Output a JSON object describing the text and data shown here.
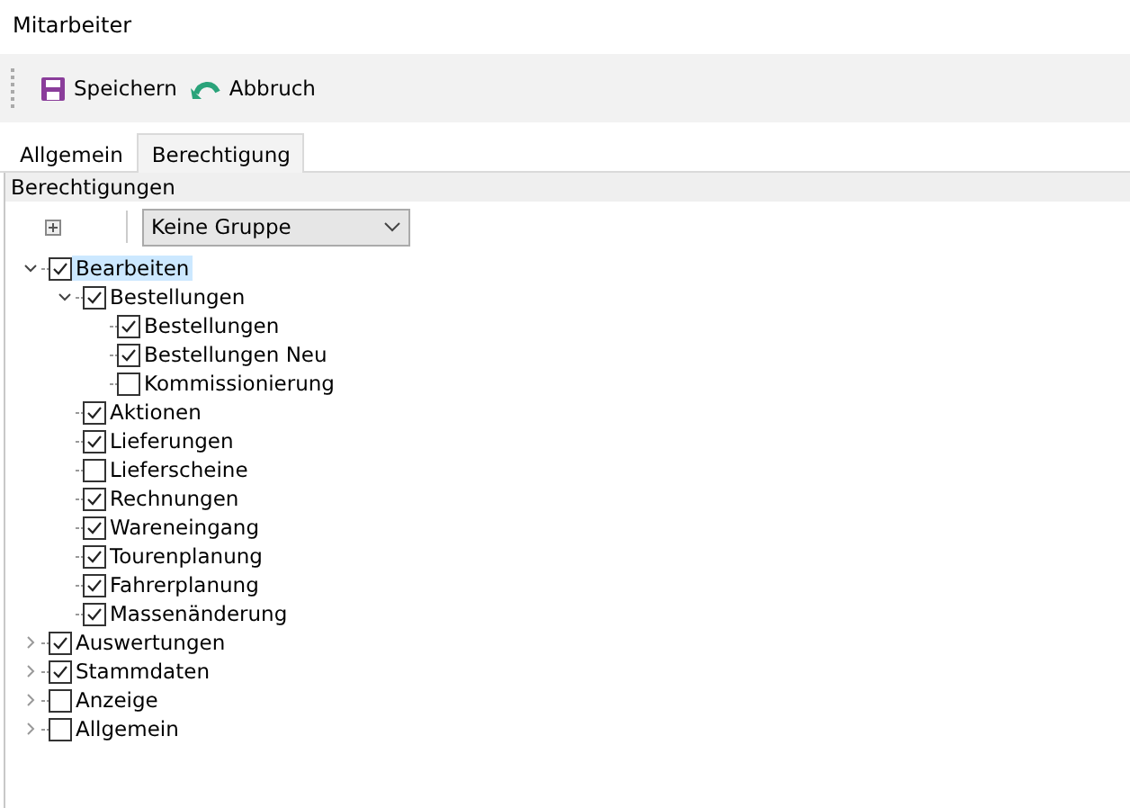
{
  "window": {
    "title": "Mitarbeiter"
  },
  "toolbar": [
    {
      "kind": "save",
      "label": "Speichern"
    },
    {
      "kind": "undo",
      "label": "Abbruch"
    }
  ],
  "tabs": [
    {
      "label": "Allgemein",
      "selected": false
    },
    {
      "label": "Berechtigung",
      "selected": true
    }
  ],
  "group": {
    "title": "Berechtigungen",
    "dropdown": "Keine Gruppe"
  },
  "tree": [
    {
      "label": "Bearbeiten",
      "checked": true,
      "selected": true,
      "expanded": true,
      "children": [
        {
          "label": "Bestellungen",
          "checked": true,
          "selected": false,
          "expanded": true,
          "children": [
            {
              "label": "Bestellungen",
              "checked": true,
              "selected": false
            },
            {
              "label": "Bestellungen Neu",
              "checked": true,
              "selected": false
            },
            {
              "label": "Kommissionierung",
              "checked": false,
              "selected": false
            }
          ]
        },
        {
          "label": "Aktionen",
          "checked": true,
          "selected": false
        },
        {
          "label": "Lieferungen",
          "checked": true,
          "selected": false
        },
        {
          "label": "Lieferscheine",
          "checked": false,
          "selected": false
        },
        {
          "label": "Rechnungen",
          "checked": true,
          "selected": false
        },
        {
          "label": "Wareneingang",
          "checked": true,
          "selected": false
        },
        {
          "label": "Tourenplanung",
          "checked": true,
          "selected": false
        },
        {
          "label": "Fahrerplanung",
          "checked": true,
          "selected": false
        },
        {
          "label": "Massenänderung",
          "checked": true,
          "selected": false
        }
      ]
    },
    {
      "label": "Auswertungen",
      "checked": true,
      "selected": false,
      "expanded": false
    },
    {
      "label": "Stammdaten",
      "checked": true,
      "selected": false,
      "expanded": false
    },
    {
      "label": "Anzeige",
      "checked": false,
      "selected": false,
      "expanded": false
    },
    {
      "label": "Allgemein",
      "checked": false,
      "selected": false,
      "expanded": false
    }
  ]
}
